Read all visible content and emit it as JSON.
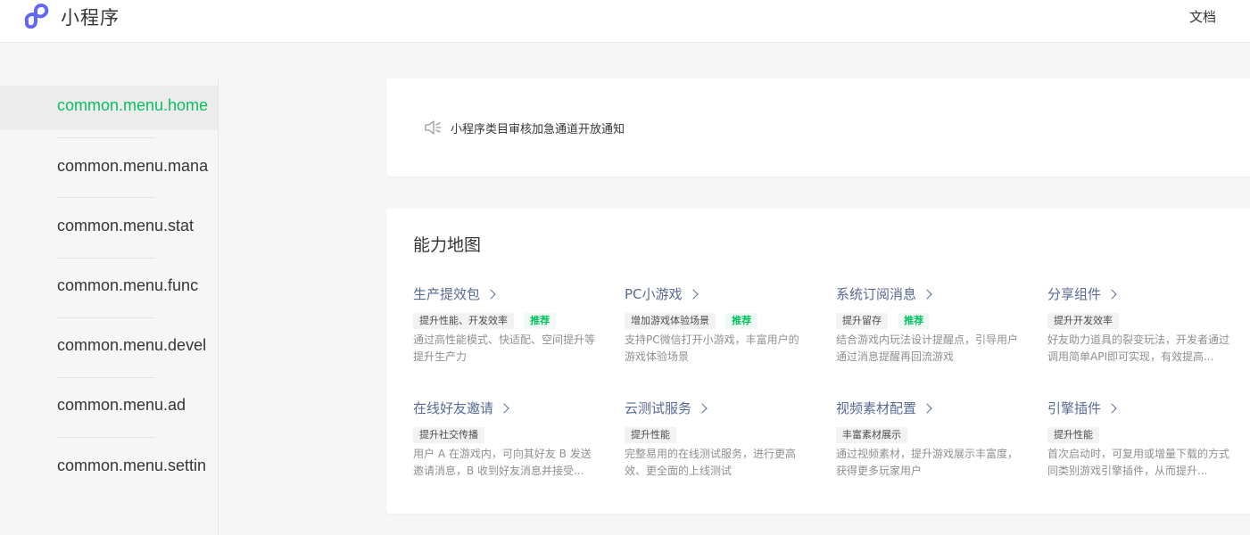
{
  "header": {
    "brand": "小程序",
    "docs_link": "文档",
    "brand_color": "#6467f0"
  },
  "sidebar": {
    "active_color": "#07c160",
    "items": [
      {
        "label": "common.menu.home",
        "active": true
      },
      {
        "label": "common.menu.mana"
      },
      {
        "label": "common.menu.stat"
      },
      {
        "label": "common.menu.func"
      },
      {
        "label": "common.menu.devel"
      },
      {
        "label": "common.menu.ad"
      },
      {
        "label": "common.menu.settin"
      }
    ]
  },
  "notice": {
    "icon": "speaker-icon",
    "text": "小程序类目审核加急通道开放通知"
  },
  "capability_map": {
    "title": "能力地图",
    "features": [
      {
        "title": "生产提效包",
        "tags": [
          "提升性能、开发效率"
        ],
        "recommended": "推荐",
        "desc": "通过高性能模式、快适配、空间提升等提升生产力"
      },
      {
        "title": "PC小游戏",
        "tags": [
          "增加游戏体验场景"
        ],
        "recommended": "推荐",
        "desc": "支持PC微信打开小游戏，丰富用户的游戏体验场景"
      },
      {
        "title": "系统订阅消息",
        "tags": [
          "提升留存"
        ],
        "recommended": "推荐",
        "desc": "结合游戏内玩法设计提醒点，引导用户通过消息提醒再回流游戏"
      },
      {
        "title": "分享组件",
        "tags": [
          "提升开发效率"
        ],
        "desc": "好友助力道具的裂变玩法，开发者通过调用简单API即可实现，有效提高..."
      },
      {
        "title": "在线好友邀请",
        "tags": [
          "提升社交传播"
        ],
        "desc": "用户 A 在游戏内，可向其好友 B 发送邀请消息，B 收到好友消息并接受..."
      },
      {
        "title": "云测试服务",
        "tags": [
          "提升性能"
        ],
        "desc": "完整易用的在线测试服务，进行更高效、更全面的上线测试"
      },
      {
        "title": "视频素材配置",
        "tags": [
          "丰富素材展示"
        ],
        "desc": "通过视频素材，提升游戏展示丰富度，获得更多玩家用户"
      },
      {
        "title": "引擎插件",
        "tags": [
          "提升性能"
        ],
        "desc": "首次启动时，可复用或增量下载的方式同类别游戏引擎插件，从而提升..."
      }
    ]
  }
}
